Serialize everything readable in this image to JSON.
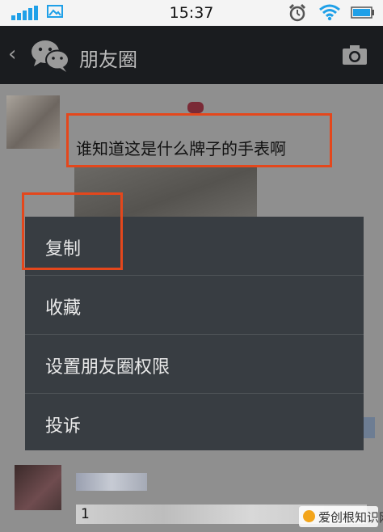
{
  "status_bar": {
    "time": "15:37",
    "signal_icon": "signal-bars-icon",
    "image_icon": "picture-icon",
    "alarm_icon": "alarm-clock-icon",
    "wifi_icon": "wifi-icon",
    "battery_icon": "battery-icon",
    "accent_color": "#1fa0e8"
  },
  "nav": {
    "back_glyph": "‹",
    "logo_icon": "wechat-logo-icon",
    "title": "朋友圈",
    "camera_icon": "camera-icon",
    "background": "#1a1c1f"
  },
  "post": {
    "text": "谁知道这是什么牌子的手表啊"
  },
  "context_menu": {
    "items": [
      {
        "label": "复制"
      },
      {
        "label": "收藏"
      },
      {
        "label": "设置朋友圈权限"
      },
      {
        "label": "投诉"
      }
    ],
    "background": "#383d42"
  },
  "next_post": {
    "number": "1"
  },
  "watermark": {
    "text": "爱创根知识网"
  },
  "highlight_color": "#e4471c"
}
